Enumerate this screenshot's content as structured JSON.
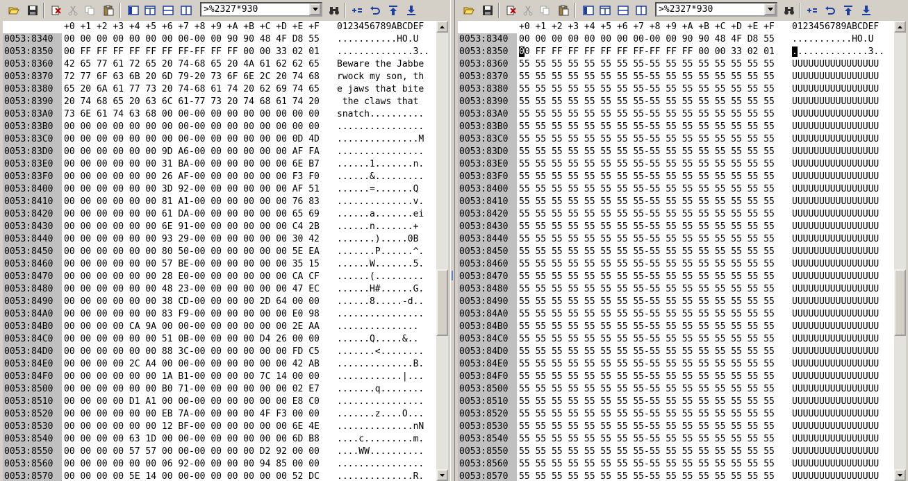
{
  "address_value": ">%2327*930",
  "header": {
    "cols": [
      "+0",
      "+1",
      "+2",
      "+3",
      "+4",
      "+5",
      "+6",
      "+7",
      "+8",
      "+9",
      "+A",
      "+B",
      "+C",
      "+D",
      "+E",
      "+F"
    ],
    "ascii": "0123456789ABCDEF"
  },
  "left": {
    "rows": [
      {
        "a": "0053:8340",
        "h": "00 00 00 00 00 00 00 00-00 00 90 90 48 4F D8 55",
        "t": "...........HO.U"
      },
      {
        "a": "0053:8350",
        "h": "00 FF FF FF FF FF FF FF-FF FF FF 00 00 33 02 01",
        "t": "..............3.."
      },
      {
        "a": "0053:8360",
        "h": "42 65 77 61 72 65 20 74-68 65 20 4A 61 62 62 65",
        "t": "Beware the Jabbe"
      },
      {
        "a": "0053:8370",
        "h": "72 77 6F 63 6B 20 6D 79-20 73 6F 6E 2C 20 74 68",
        "t": "rwock my son, th"
      },
      {
        "a": "0053:8380",
        "h": "65 20 6A 61 77 73 20 74-68 61 74 20 62 69 74 65",
        "t": "e jaws that bite"
      },
      {
        "a": "0053:8390",
        "h": "20 74 68 65 20 63 6C 61-77 73 20 74 68 61 74 20",
        "t": " the claws that "
      },
      {
        "a": "0053:83A0",
        "h": "73 6E 61 74 63 68 00 00-00 00 00 00 00 00 00 00",
        "t": "snatch.........."
      },
      {
        "a": "0053:83B0",
        "h": "00 00 00 00 00 00 00 00-00 00 00 00 00 00 00 00",
        "t": "................"
      },
      {
        "a": "0053:83C0",
        "h": "00 00 00 00 00 00 00 00-00 00 00 00 00 00 0D 4D",
        "t": "...............M"
      },
      {
        "a": "0053:83D0",
        "h": "00 00 00 00 00 00 9D A6-00 00 00 00 00 00 AF FA",
        "t": "................"
      },
      {
        "a": "0053:83E0",
        "h": "00 00 00 00 00 00 31 BA-00 00 00 00 00 00 6E B7",
        "t": "......1.......n."
      },
      {
        "a": "0053:83F0",
        "h": "00 00 00 00 00 00 26 AF-00 00 00 00 00 00 F3 F0",
        "t": "......&........."
      },
      {
        "a": "0053:8400",
        "h": "00 00 00 00 00 00 3D 92-00 00 00 00 00 00 AF 51",
        "t": "......=.......Q"
      },
      {
        "a": "0053:8410",
        "h": "00 00 00 00 00 00 81 A1-00 00 00 00 00 00 76 83",
        "t": "..............v."
      },
      {
        "a": "0053:8420",
        "h": "00 00 00 00 00 00 61 DA-00 00 00 00 00 00 65 69",
        "t": "......a.......ei"
      },
      {
        "a": "0053:8430",
        "h": "00 00 00 00 00 00 6E 91-00 00 00 00 00 00 C4 2B",
        "t": "......n.......+"
      },
      {
        "a": "0053:8440",
        "h": "00 00 00 00 00 00 93 29-00 00 00 00 00 00 30 42",
        "t": ".......).....0B"
      },
      {
        "a": "0053:8450",
        "h": "00 00 00 00 00 00 80 50-00 00 00 00 00 00 5E EA",
        "t": ".......P......^."
      },
      {
        "a": "0053:8460",
        "h": "00 00 00 00 00 00 57 BE-00 00 00 00 00 00 35 15",
        "t": "......W.......5."
      },
      {
        "a": "0053:8470",
        "h": "00 00 00 00 00 00 28 E0-00 00 00 00 00 00 CA CF",
        "t": "......(........."
      },
      {
        "a": "0053:8480",
        "h": "00 00 00 00 00 00 48 23-00 00 00 00 00 00 47 EC",
        "t": "......H#......G."
      },
      {
        "a": "0053:8490",
        "h": "00 00 00 00 00 00 38 CD-00 00 00 00 2D 64 00 00",
        "t": "......8.....-d.."
      },
      {
        "a": "0053:84A0",
        "h": "00 00 00 00 00 00 83 F9-00 00 00 00 00 00 E0 98",
        "t": "................"
      },
      {
        "a": "0053:84B0",
        "h": "00 00 00 00 CA 9A 00 00-00 00 00 00 00 00 2E AA",
        "t": "..............."
      },
      {
        "a": "0053:84C0",
        "h": "00 00 00 00 00 00 51 0B-00 00 00 00 D4 26 00 00",
        "t": "......Q.....&.."
      },
      {
        "a": "0053:84D0",
        "h": "00 00 00 00 00 00 88 3C-00 00 00 00 00 00 FD C5",
        "t": ".......<........"
      },
      {
        "a": "0053:84E0",
        "h": "00 00 00 00 2C A4 00 00-00 00 00 00 00 00 42 AB",
        "t": "..............B."
      },
      {
        "a": "0053:84F0",
        "h": "00 00 00 00 00 00 1A B1-00 00 00 00 7C 14 00 00",
        "t": "............|..."
      },
      {
        "a": "0053:8500",
        "h": "00 00 00 00 00 00 B0 71-00 00 00 00 00 00 02 E7",
        "t": ".......q........"
      },
      {
        "a": "0053:8510",
        "h": "00 00 00 00 D1 A1 00 00-00 00 00 00 00 00 E8 C0",
        "t": "................"
      },
      {
        "a": "0053:8520",
        "h": "00 00 00 00 00 00 EB 7A-00 00 00 00 4F F3 00 00",
        "t": ".......z....O..."
      },
      {
        "a": "0053:8530",
        "h": "00 00 00 00 00 00 12 BF-00 00 00 00 00 00 6E 4E",
        "t": "..............nN"
      },
      {
        "a": "0053:8540",
        "h": "00 00 00 00 63 1D 00 00-00 00 00 00 00 00 6D B8",
        "t": "....c.........m."
      },
      {
        "a": "0053:8550",
        "h": "00 00 00 00 57 57 00 00-00 00 00 00 D2 92 00 00",
        "t": "....WW.........."
      },
      {
        "a": "0053:8560",
        "h": "00 00 00 00 00 00 06 92-00 00 00 00 94 85 00 00",
        "t": "................"
      },
      {
        "a": "0053:8570",
        "h": "00 00 00 00 5E 14 00 00-00 00 00 00 00 00 52 DC",
        "t": "..............R."
      }
    ]
  },
  "right": {
    "rows": [
      {
        "a": "0053:8340",
        "h": "00 00 00 00 00 00 00 00-00 00 90 90 48 4F D8 55",
        "t": "...........HO.U"
      },
      {
        "a": "0053:8350",
        "h": "00 FF FF FF FF FF FF FF-FF FF FF 00 00 33 02 01",
        "t": "..............3.."
      },
      {
        "a": "0053:8360",
        "h": "55 55 55 55 55 55 55 55-55 55 55 55 55 55 55 55",
        "t": "UUUUUUUUUUUUUUUU"
      },
      {
        "a": "0053:8370",
        "h": "55 55 55 55 55 55 55 55-55 55 55 55 55 55 55 55",
        "t": "UUUUUUUUUUUUUUUU"
      },
      {
        "a": "0053:8380",
        "h": "55 55 55 55 55 55 55 55-55 55 55 55 55 55 55 55",
        "t": "UUUUUUUUUUUUUUUU"
      },
      {
        "a": "0053:8390",
        "h": "55 55 55 55 55 55 55 55-55 55 55 55 55 55 55 55",
        "t": "UUUUUUUUUUUUUUUU"
      },
      {
        "a": "0053:83A0",
        "h": "55 55 55 55 55 55 55 55-55 55 55 55 55 55 55 55",
        "t": "UUUUUUUUUUUUUUUU"
      },
      {
        "a": "0053:83B0",
        "h": "55 55 55 55 55 55 55 55-55 55 55 55 55 55 55 55",
        "t": "UUUUUUUUUUUUUUUU"
      },
      {
        "a": "0053:83C0",
        "h": "55 55 55 55 55 55 55 55-55 55 55 55 55 55 55 55",
        "t": "UUUUUUUUUUUUUUUU"
      },
      {
        "a": "0053:83D0",
        "h": "55 55 55 55 55 55 55 55-55 55 55 55 55 55 55 55",
        "t": "UUUUUUUUUUUUUUUU"
      },
      {
        "a": "0053:83E0",
        "h": "55 55 55 55 55 55 55 55-55 55 55 55 55 55 55 55",
        "t": "UUUUUUUUUUUUUUUU"
      },
      {
        "a": "0053:83F0",
        "h": "55 55 55 55 55 55 55 55-55 55 55 55 55 55 55 55",
        "t": "UUUUUUUUUUUUUUUU"
      },
      {
        "a": "0053:8400",
        "h": "55 55 55 55 55 55 55 55-55 55 55 55 55 55 55 55",
        "t": "UUUUUUUUUUUUUUUU"
      },
      {
        "a": "0053:8410",
        "h": "55 55 55 55 55 55 55 55-55 55 55 55 55 55 55 55",
        "t": "UUUUUUUUUUUUUUUU"
      },
      {
        "a": "0053:8420",
        "h": "55 55 55 55 55 55 55 55-55 55 55 55 55 55 55 55",
        "t": "UUUUUUUUUUUUUUUU"
      },
      {
        "a": "0053:8430",
        "h": "55 55 55 55 55 55 55 55-55 55 55 55 55 55 55 55",
        "t": "UUUUUUUUUUUUUUUU"
      },
      {
        "a": "0053:8440",
        "h": "55 55 55 55 55 55 55 55-55 55 55 55 55 55 55 55",
        "t": "UUUUUUUUUUUUUUUU"
      },
      {
        "a": "0053:8450",
        "h": "55 55 55 55 55 55 55 55-55 55 55 55 55 55 55 55",
        "t": "UUUUUUUUUUUUUUUU"
      },
      {
        "a": "0053:8460",
        "h": "55 55 55 55 55 55 55 55-55 55 55 55 55 55 55 55",
        "t": "UUUUUUUUUUUUUUUU"
      },
      {
        "a": "0053:8470",
        "h": "55 55 55 55 55 55 55 55-55 55 55 55 55 55 55 55",
        "t": "UUUUUUUUUUUUUUUU"
      },
      {
        "a": "0053:8480",
        "h": "55 55 55 55 55 55 55 55-55 55 55 55 55 55 55 55",
        "t": "UUUUUUUUUUUUUUUU"
      },
      {
        "a": "0053:8490",
        "h": "55 55 55 55 55 55 55 55-55 55 55 55 55 55 55 55",
        "t": "UUUUUUUUUUUUUUUU"
      },
      {
        "a": "0053:84A0",
        "h": "55 55 55 55 55 55 55 55-55 55 55 55 55 55 55 55",
        "t": "UUUUUUUUUUUUUUUU"
      },
      {
        "a": "0053:84B0",
        "h": "55 55 55 55 55 55 55 55-55 55 55 55 55 55 55 55",
        "t": "UUUUUUUUUUUUUUUU"
      },
      {
        "a": "0053:84C0",
        "h": "55 55 55 55 55 55 55 55-55 55 55 55 55 55 55 55",
        "t": "UUUUUUUUUUUUUUUU"
      },
      {
        "a": "0053:84D0",
        "h": "55 55 55 55 55 55 55 55-55 55 55 55 55 55 55 55",
        "t": "UUUUUUUUUUUUUUUU"
      },
      {
        "a": "0053:84E0",
        "h": "55 55 55 55 55 55 55 55-55 55 55 55 55 55 55 55",
        "t": "UUUUUUUUUUUUUUUU"
      },
      {
        "a": "0053:84F0",
        "h": "55 55 55 55 55 55 55 55-55 55 55 55 55 55 55 55",
        "t": "UUUUUUUUUUUUUUUU"
      },
      {
        "a": "0053:8500",
        "h": "55 55 55 55 55 55 55 55-55 55 55 55 55 55 55 55",
        "t": "UUUUUUUUUUUUUUUU"
      },
      {
        "a": "0053:8510",
        "h": "55 55 55 55 55 55 55 55-55 55 55 55 55 55 55 55",
        "t": "UUUUUUUUUUUUUUUU"
      },
      {
        "a": "0053:8520",
        "h": "55 55 55 55 55 55 55 55-55 55 55 55 55 55 55 55",
        "t": "UUUUUUUUUUUUUUUU"
      },
      {
        "a": "0053:8530",
        "h": "55 55 55 55 55 55 55 55-55 55 55 55 55 55 55 55",
        "t": "UUUUUUUUUUUUUUUU"
      },
      {
        "a": "0053:8540",
        "h": "55 55 55 55 55 55 55 55-55 55 55 55 55 55 55 55",
        "t": "UUUUUUUUUUUUUUUU"
      },
      {
        "a": "0053:8550",
        "h": "55 55 55 55 55 55 55 55-55 55 55 55 55 55 55 55",
        "t": "UUUUUUUUUUUUUUUU"
      },
      {
        "a": "0053:8560",
        "h": "55 55 55 55 55 55 55 55-55 55 55 55 55 55 55 55",
        "t": "UUUUUUUUUUUUUUUU"
      },
      {
        "a": "0053:8570",
        "h": "55 55 55 55 55 55 55 55-55 55 55 55 55 55 55 55",
        "t": "UUUUUUUUUUUUUUUU"
      }
    ]
  },
  "colors": {
    "address_column": "#c0c0c0",
    "cursor": "#000000",
    "icon_blue": "#1f3f9f",
    "icon_red": "#c00000"
  }
}
